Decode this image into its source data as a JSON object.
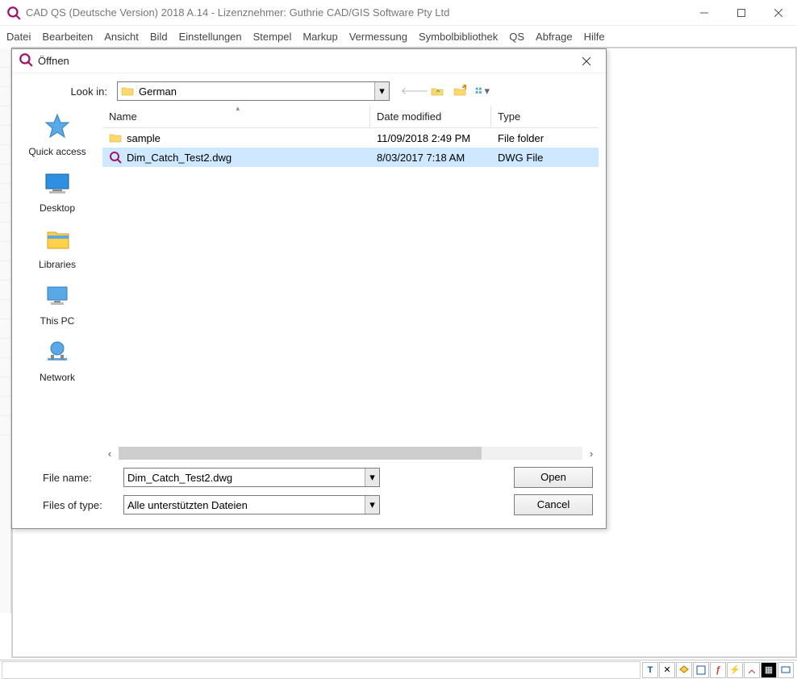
{
  "app": {
    "title": "CAD QS (Deutsche Version) 2018 A.14 - Lizenznehmer: Guthrie CAD/GIS Software Pty Ltd"
  },
  "menubar": [
    "Datei",
    "Bearbeiten",
    "Ansicht",
    "Bild",
    "Einstellungen",
    "Stempel",
    "Markup",
    "Vermessung",
    "Symbolbibliothek",
    "QS",
    "Abfrage",
    "Hilfe"
  ],
  "dialog": {
    "title": "Öffnen",
    "lookin_label": "Look in:",
    "lookin_value": "German",
    "columns": {
      "name": "Name",
      "date": "Date modified",
      "type": "Type"
    },
    "rows": [
      {
        "icon": "folder",
        "name": "sample",
        "date": "11/09/2018 2:49 PM",
        "type": "File folder",
        "selected": false
      },
      {
        "icon": "dwg",
        "name": "Dim_Catch_Test2.dwg",
        "date": "8/03/2017 7:18 AM",
        "type": "DWG File",
        "selected": true
      }
    ],
    "places": [
      {
        "key": "quickaccess",
        "label": "Quick access"
      },
      {
        "key": "desktop",
        "label": "Desktop"
      },
      {
        "key": "libraries",
        "label": "Libraries"
      },
      {
        "key": "thispc",
        "label": "This PC"
      },
      {
        "key": "network",
        "label": "Network"
      }
    ],
    "filename_label": "File name:",
    "filename_value": "Dim_Catch_Test2.dwg",
    "filetype_label": "Files of type:",
    "filetype_value": "Alle unterstützten Dateien",
    "open_btn": "Open",
    "cancel_btn": "Cancel"
  }
}
